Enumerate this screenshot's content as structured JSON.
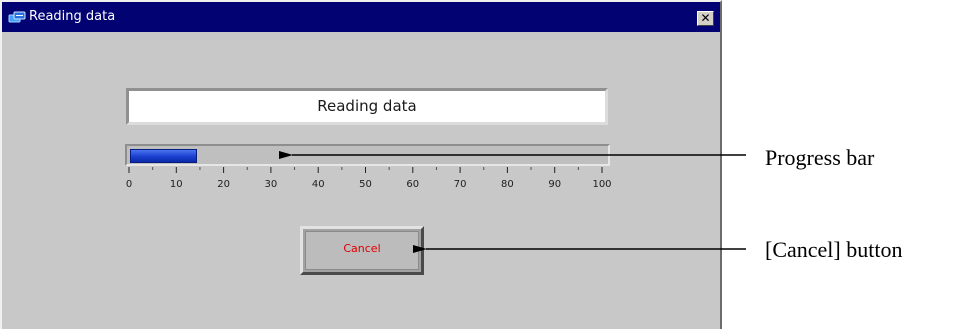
{
  "window": {
    "title": "Reading data",
    "close_glyph": "✕",
    "icon": "data-transfer-icon"
  },
  "status": {
    "text": "Reading data"
  },
  "progress": {
    "value": 14,
    "min": 0,
    "max": 100,
    "ticks": [
      "0",
      "10",
      "20",
      "30",
      "40",
      "50",
      "60",
      "70",
      "80",
      "90",
      "100"
    ],
    "fill_color": "#1a3fd0"
  },
  "buttons": {
    "cancel_label": "Cancel",
    "cancel_text_color": "#e00000"
  },
  "annotations": {
    "progress_bar_label": "Progress bar",
    "cancel_button_label": "[Cancel] button"
  }
}
